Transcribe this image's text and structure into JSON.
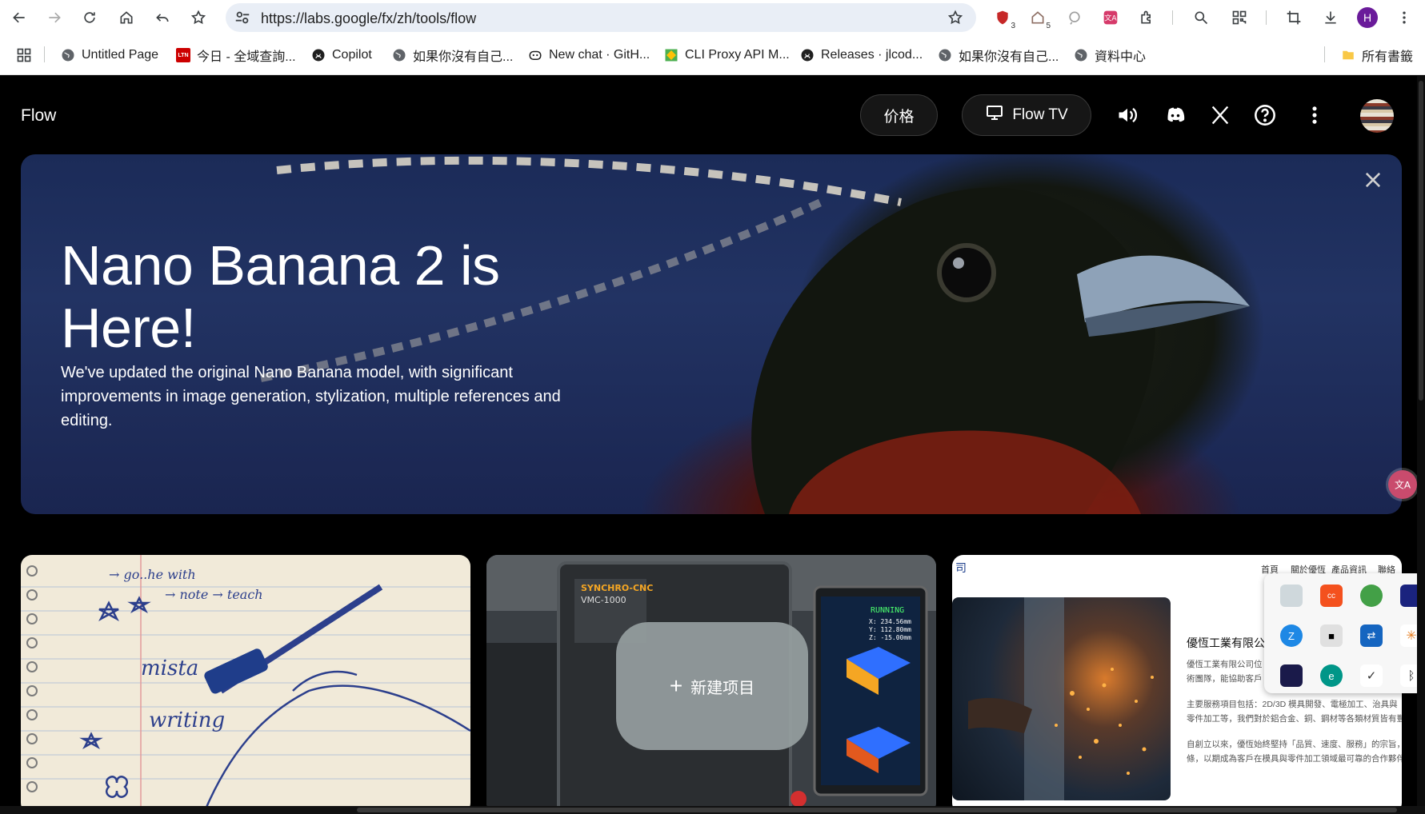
{
  "browser": {
    "url": "https://labs.google/fx/zh/tools/flow",
    "profile_initial": "H",
    "extension_badges": [
      "3",
      "5"
    ],
    "bookmarks": [
      {
        "label": "Untitled Page",
        "icon": "globe-icon"
      },
      {
        "label": "今日 - 全域查詢...",
        "icon": "ltn-icon",
        "icon_text": "LTN"
      },
      {
        "label": "Copilot",
        "icon": "github-icon"
      },
      {
        "label": "如果你沒有自己...",
        "icon": "globe-icon"
      },
      {
        "label": "New chat · GitH...",
        "icon": "copilot-icon"
      },
      {
        "label": "CLI Proxy API M...",
        "icon": "diamond-icon"
      },
      {
        "label": "Releases · jlcod...",
        "icon": "github-icon"
      },
      {
        "label": "如果你沒有自己...",
        "icon": "globe-icon"
      },
      {
        "label": "資料中心",
        "icon": "globe-icon"
      }
    ],
    "all_bookmarks_label": "所有書籤"
  },
  "app": {
    "logo": "Flow",
    "pricing_label": "价格",
    "flow_tv_label": "Flow TV"
  },
  "hero": {
    "title": "Nano Banana 2 is Here!",
    "subtitle": "We've updated the original Nano Banana model, with significant improvements in image generation, stylization, multiple references and editing."
  },
  "new_project_label": "新建项目",
  "card3": {
    "nav": [
      "首頁",
      "關於優恆",
      "產品資訊",
      "聯絡"
    ],
    "logo_text": "司",
    "company": "優恆工業有限公司",
    "lines": [
      "優恆工業有限公司位",
      "術團隊，能協助客戶",
      "主要服務項目包括：2D/3D 模具開發、電極加工、治具與",
      "零件加工等，我們對於鋁合金、銅、鋼材等各類材質皆有豐",
      "自創立以來，優恆始終堅持「品質、速度、服務」的宗旨，",
      "條，以期成為客戶在模具與零件加工領域最可靠的合作夥伴"
    ]
  },
  "card2": {
    "machine_brand": "SYNCHRO-CNC",
    "machine_model": "VMC-1000",
    "status": "RUNNING",
    "readout": [
      "X: 234.56mm",
      "Y: 112.80mm",
      "Z: -15.00mm"
    ]
  },
  "colors": {
    "accent_profile": "#6a1b9a",
    "translate_fab": "#c94b6d",
    "hero_sky": "#1b2b58",
    "new_project_bg": "#969ea0"
  }
}
